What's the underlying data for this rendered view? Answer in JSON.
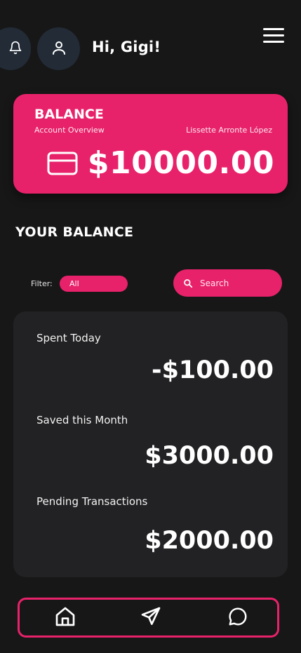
{
  "header": {
    "greeting": "Hi, Gigi!",
    "icons": [
      "bell-icon",
      "user-icon",
      "hamburger-menu-icon"
    ]
  },
  "balance_card": {
    "title": "BALANCE",
    "subtitle": "Account Overview",
    "account_holder": "Lissette Arronte López",
    "amount": "$10000.00",
    "icon": "credit-card-icon"
  },
  "section": {
    "title": "YOUR BALANCE"
  },
  "filter": {
    "label": "Filter:",
    "selected": "All"
  },
  "search": {
    "placeholder": "Search",
    "icon": "search-icon"
  },
  "stats": [
    {
      "label": "Spent Today",
      "value": "-$100.00"
    },
    {
      "label": "Saved this Month",
      "value": "$3000.00"
    },
    {
      "label": "Pending Transactions",
      "value": "$2000.00"
    }
  ],
  "bottom_nav": {
    "items": [
      "home-icon",
      "send-icon",
      "chat-icon"
    ]
  },
  "colors": {
    "background": "#171717",
    "accent": "#e8226a",
    "card": "#222224",
    "icon_button": "#222b36"
  }
}
